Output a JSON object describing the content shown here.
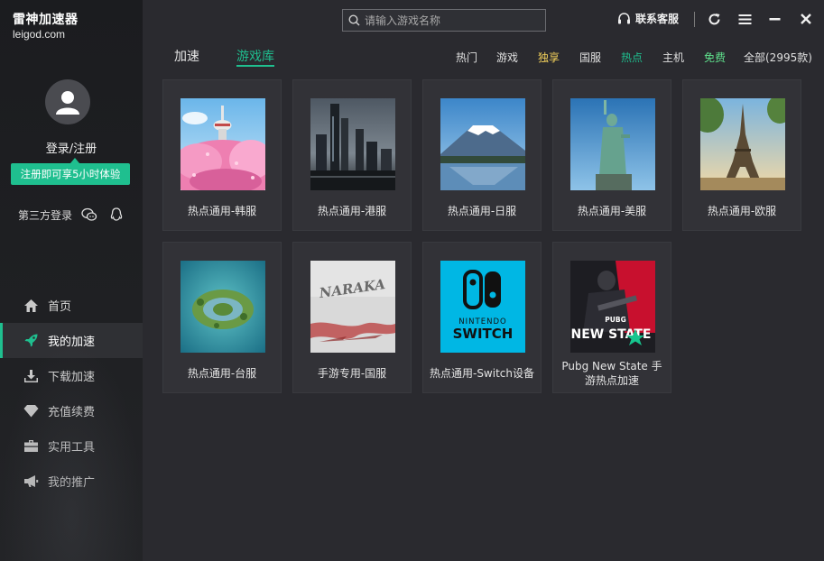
{
  "app": {
    "logo_main": "雷神加速器",
    "logo_sub": "leigod.com"
  },
  "user": {
    "login_label": "登录/注册",
    "trial_badge": "注册即可享5小时体验",
    "third_party_label": "第三方登录"
  },
  "sidebar": {
    "items": [
      {
        "label": "首页",
        "icon": "home-icon"
      },
      {
        "label": "我的加速",
        "icon": "rocket-icon",
        "active": true
      },
      {
        "label": "下载加速",
        "icon": "download-icon"
      },
      {
        "label": "充值续费",
        "icon": "diamond-icon"
      },
      {
        "label": "实用工具",
        "icon": "toolbox-icon"
      },
      {
        "label": "我的推广",
        "icon": "megaphone-icon"
      }
    ]
  },
  "header": {
    "search_placeholder": "请输入游戏名称",
    "service_label": "联系客服"
  },
  "tabs": {
    "primary": [
      {
        "label": "加速"
      },
      {
        "label": "游戏库",
        "active": true
      }
    ],
    "categories": [
      {
        "label": "热门",
        "color": "#e0e0e0"
      },
      {
        "label": "游戏",
        "color": "#e0e0e0"
      },
      {
        "label": "独享",
        "color": "#f5d35c"
      },
      {
        "label": "国服",
        "color": "#e0e0e0"
      },
      {
        "label": "热点",
        "color": "#1fbf8f"
      },
      {
        "label": "主机",
        "color": "#e0e0e0"
      },
      {
        "label": "免费",
        "color": "#5fe08c"
      },
      {
        "label": "全部(2995款)",
        "color": "#e0e0e0"
      }
    ]
  },
  "games": [
    {
      "title": "热点通用-韩服",
      "thumb": "seoul-tower-cherry-blossom"
    },
    {
      "title": "热点通用-港服",
      "thumb": "hong-kong-skyline"
    },
    {
      "title": "热点通用-日服",
      "thumb": "mount-fuji"
    },
    {
      "title": "热点通用-美服",
      "thumb": "statue-of-liberty"
    },
    {
      "title": "热点通用-欧服",
      "thumb": "eiffel-tower"
    },
    {
      "title": "热点通用-台服",
      "thumb": "island-aerial"
    },
    {
      "title": "手游专用-国服",
      "thumb": "naraka-logo"
    },
    {
      "title": "热点通用-Switch设备",
      "thumb": "nintendo-switch"
    },
    {
      "title": "Pubg New State 手游热点加速",
      "thumb": "pubg-new-state"
    }
  ],
  "thumb_text": {
    "naraka": "NARAKA",
    "switch_top": "NINTENDO",
    "switch_bottom": "SWITCH",
    "pubg_small": "PUBG",
    "pubg_big": "NEW STATE"
  },
  "colors": {
    "accent": "#1fbf8f",
    "sidebar_bg": "#1f2023",
    "main_bg": "#2a2a2f",
    "card_bg": "#323237"
  }
}
